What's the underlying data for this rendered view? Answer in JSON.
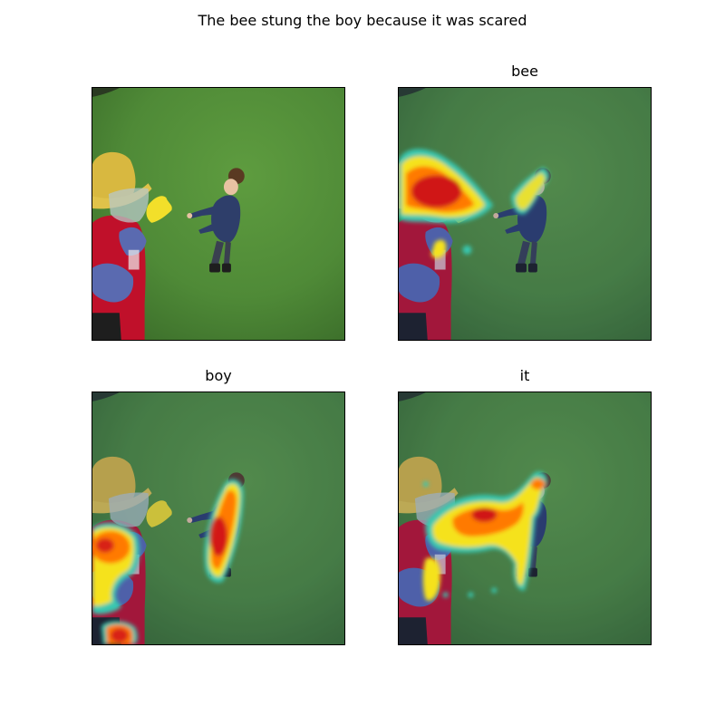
{
  "figure": {
    "title": "The bee stung the boy because it was scared"
  },
  "panels": [
    {
      "title": "",
      "overlay": "none"
    },
    {
      "title": "bee",
      "overlay": "attention-heatmap"
    },
    {
      "title": "boy",
      "overlay": "attention-heatmap"
    },
    {
      "title": "it",
      "overlay": "attention-heatmap"
    }
  ],
  "colors": {
    "grass": "#4f8a37",
    "grass_dark": "#3d6f2a",
    "heat_high": "#c8001a",
    "heat_mid": "#ff7a00",
    "heat_low": "#f5e21a",
    "heat_edge": "#37c8b0",
    "heat_outline": "#2040a8"
  }
}
